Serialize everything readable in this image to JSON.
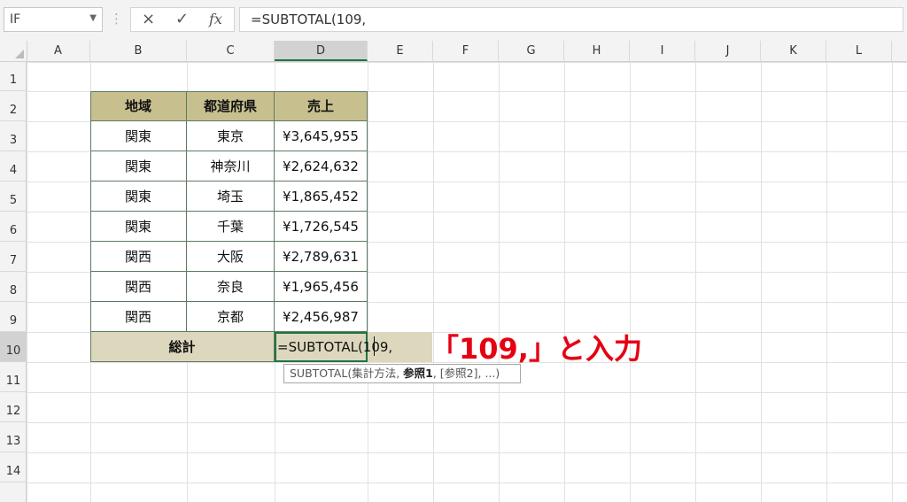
{
  "formula_bar": {
    "name_box": "IF",
    "cancel_icon": "×",
    "enter_icon": "✓",
    "fx_icon": "fx",
    "formula": "=SUBTOTAL(109,"
  },
  "columns": [
    "A",
    "B",
    "C",
    "D",
    "E",
    "F",
    "G",
    "H",
    "I",
    "J",
    "K",
    "L"
  ],
  "rows": [
    "1",
    "2",
    "3",
    "4",
    "5",
    "6",
    "7",
    "8",
    "9",
    "10",
    "11",
    "12",
    "13",
    "14"
  ],
  "active_cell": "D10",
  "table": {
    "headers": [
      "地域",
      "都道府県",
      "売上"
    ],
    "rows": [
      [
        "関東",
        "東京",
        "¥3,645,955"
      ],
      [
        "関東",
        "神奈川",
        "¥2,624,632"
      ],
      [
        "関東",
        "埼玉",
        "¥1,865,452"
      ],
      [
        "関東",
        "千葉",
        "¥1,726,545"
      ],
      [
        "関西",
        "大阪",
        "¥2,789,631"
      ],
      [
        "関西",
        "奈良",
        "¥1,965,456"
      ],
      [
        "関西",
        "京都",
        "¥2,456,987"
      ]
    ],
    "total_label": "総計",
    "total_value": "=SUBTOTAL(109,"
  },
  "tooltip": {
    "prefix": "SUBTOTAL(集計方法, ",
    "bold": "参照1",
    "suffix": ", [参照2], ...)"
  },
  "annotation": "「109,」と入力",
  "colors": {
    "header_fill": "#c8bf8e",
    "total_fill": "#ddd8bd",
    "annotation": "#e60012",
    "selection": "#217346"
  }
}
